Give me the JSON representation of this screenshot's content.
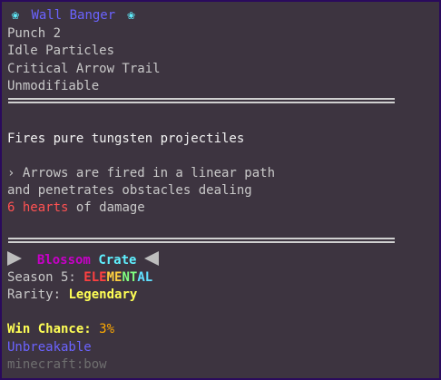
{
  "item": {
    "name": "Wall Banger",
    "flower_glyph": "❀",
    "enchants": [
      "Punch 2",
      "Idle Particles",
      "Critical Arrow Trail",
      "Unmodifiable"
    ],
    "description_title": "Fires pure tungsten projectiles",
    "description_line1": "› Arrows are fired in a linear path",
    "description_line2": "and penetrates obstacles dealing",
    "damage_value": "6 hearts",
    "damage_suffix": " of damage",
    "crate_name_part1": "Blossom",
    "crate_name_part2": "Crate",
    "season_label": "Season 5: ",
    "season_value": "ELEMENTAL",
    "rarity_label": "Rarity: ",
    "rarity_value": "Legendary",
    "win_label": "Win Chance: ",
    "win_value": "3%",
    "unbreakable": "Unbreakable",
    "item_id": "minecraft:bow"
  },
  "colors": {
    "background": "#3d3440",
    "border": "#2a0a5c",
    "title": "#6b63ff",
    "flower": "#5ff0ff",
    "damage": "#ff5252",
    "legendary": "#ffff55",
    "win_value": "#ffaa00",
    "crate_magenta": "#c800c8",
    "crate_cyan": "#5ff0ff"
  }
}
